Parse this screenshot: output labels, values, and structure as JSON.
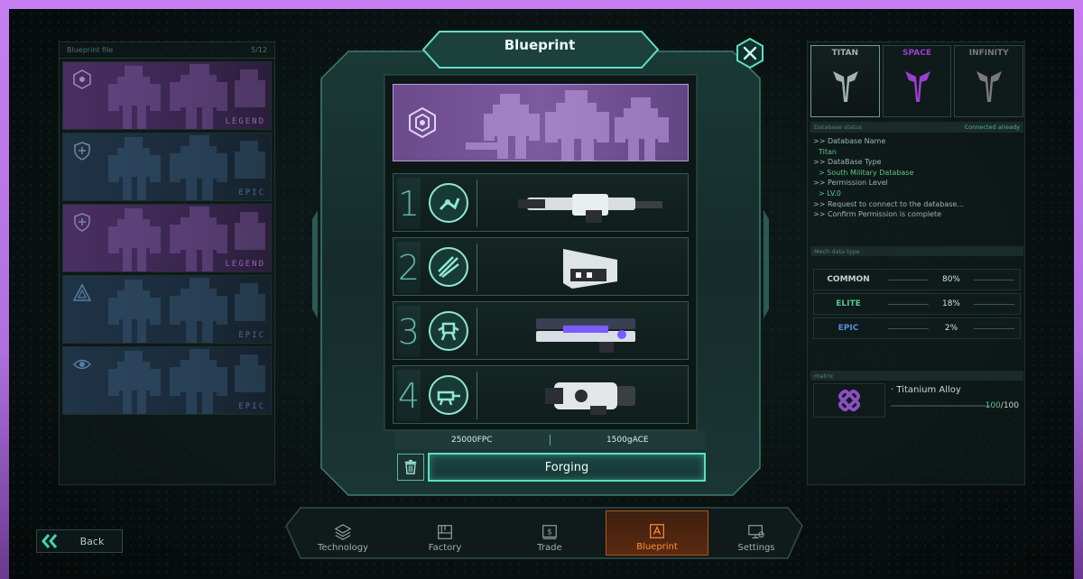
{
  "left_panel": {
    "header_title": "Blueprint file",
    "header_count": "5/12",
    "cards": [
      {
        "rarity": "LEGEND",
        "kind": "legend",
        "emblem": "hex-emblem-icon"
      },
      {
        "rarity": "EPIC",
        "kind": "epic",
        "emblem": "shield-emblem-icon"
      },
      {
        "rarity": "LEGEND",
        "kind": "legend",
        "emblem": "shield-emblem-icon"
      },
      {
        "rarity": "EPIC",
        "kind": "epic",
        "emblem": "triangle-emblem-icon"
      },
      {
        "rarity": "EPIC",
        "kind": "epic",
        "emblem": "eye-emblem-icon"
      }
    ]
  },
  "modal": {
    "title": "Blueprint",
    "slots": [
      {
        "number": "1",
        "part_icon": "arm-part-icon",
        "weapon": "railgun"
      },
      {
        "number": "2",
        "part_icon": "blades-part-icon",
        "weapon": "launcher-pod"
      },
      {
        "number": "3",
        "part_icon": "mech-part-icon",
        "weapon": "plasma-rifle"
      },
      {
        "number": "4",
        "part_icon": "cannon-part-icon",
        "weapon": "heavy-cannon"
      }
    ],
    "cost_fpc": "25000FPC",
    "cost_gace": "1500gACE",
    "forge_label": "Forging"
  },
  "right_panel": {
    "tabs": [
      {
        "label": "TITAN",
        "color": "#9fb3b0",
        "active": true
      },
      {
        "label": "SPACE",
        "color": "#9a3fd1",
        "active": false
      },
      {
        "label": "INFINITY",
        "color": "#7a7a7a",
        "active": false
      }
    ],
    "status_key": "Database status",
    "status_value": "Connected already",
    "log": [
      {
        "type": "cmd",
        "text": ">> Database Name"
      },
      {
        "type": "val",
        "text": "Titan"
      },
      {
        "type": "cmd",
        "text": ">> DataBase Type"
      },
      {
        "type": "val",
        "text": "> South Military Database"
      },
      {
        "type": "cmd",
        "text": ">> Permission Level"
      },
      {
        "type": "val",
        "text": "> LV.0"
      },
      {
        "type": "cmd",
        "text": ">> Request to connect to the database..."
      },
      {
        "type": "cmd",
        "text": ">> Confirm Permission is complete"
      }
    ],
    "mech_type_title": "Mech data type",
    "rates": [
      {
        "name": "COMMON",
        "pct": "80%",
        "color": "#c8d3d1"
      },
      {
        "name": "ELITE",
        "pct": "18%",
        "color": "#59c48f"
      },
      {
        "name": "EPIC",
        "pct": "2%",
        "color": "#5b8fd6"
      }
    ],
    "material_title": "matrix",
    "material_name": "Titanium Alloy",
    "material_have": "100",
    "material_need": "/100"
  },
  "back_label": "Back",
  "nav": [
    {
      "label": "Technology",
      "icon": "layers-icon",
      "active": false
    },
    {
      "label": "Factory",
      "icon": "factory-icon",
      "active": false
    },
    {
      "label": "Trade",
      "icon": "dollar-icon",
      "active": false
    },
    {
      "label": "Blueprint",
      "icon": "blueprint-icon",
      "active": true
    },
    {
      "label": "Settings",
      "icon": "gear-monitor-icon",
      "active": false
    }
  ],
  "colors": {
    "accent": "#58e0c4",
    "legend": "#7d5aa0",
    "epic": "#1f3447",
    "active_nav": "#ff8e3d"
  }
}
